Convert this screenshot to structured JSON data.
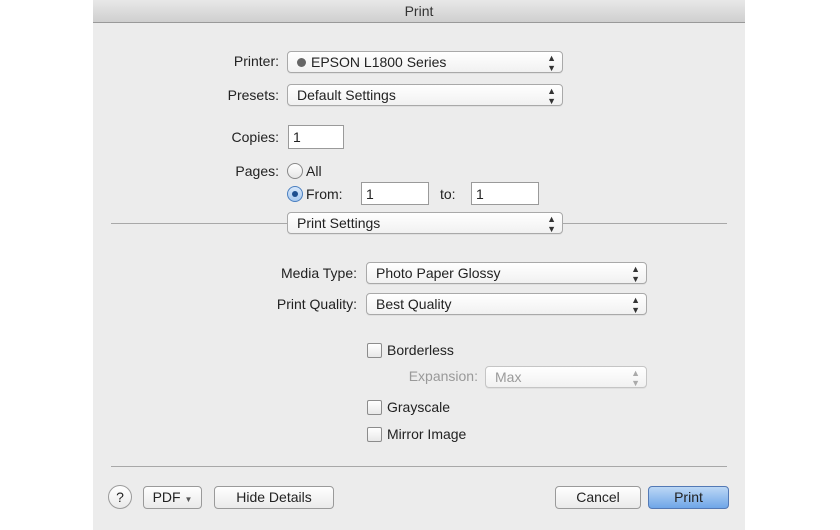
{
  "window": {
    "title": "Print"
  },
  "printer": {
    "label": "Printer:",
    "value": "EPSON L1800 Series",
    "icon": "printer-status-icon"
  },
  "presets": {
    "label": "Presets:",
    "value": "Default Settings"
  },
  "copies": {
    "label": "Copies:",
    "value": "1"
  },
  "pages": {
    "label": "Pages:",
    "all_label": "All",
    "from_label": "From:",
    "from_value": "1",
    "to_label": "to:",
    "to_value": "1",
    "selected": "From"
  },
  "section": {
    "value": "Print Settings"
  },
  "media_type": {
    "label": "Media Type:",
    "value": "Photo Paper Glossy"
  },
  "print_quality": {
    "label": "Print Quality:",
    "value": "Best Quality"
  },
  "borderless": {
    "label": "Borderless",
    "checked": false
  },
  "expansion": {
    "label": "Expansion:",
    "value": "Max",
    "disabled": true
  },
  "grayscale": {
    "label": "Grayscale",
    "checked": false
  },
  "mirror": {
    "label": "Mirror Image",
    "checked": false
  },
  "footer": {
    "help": "?",
    "pdf": "PDF",
    "hide_details": "Hide Details",
    "cancel": "Cancel",
    "print": "Print"
  },
  "colors": {
    "accent": "#6fa6e8",
    "background": "#ececec"
  }
}
